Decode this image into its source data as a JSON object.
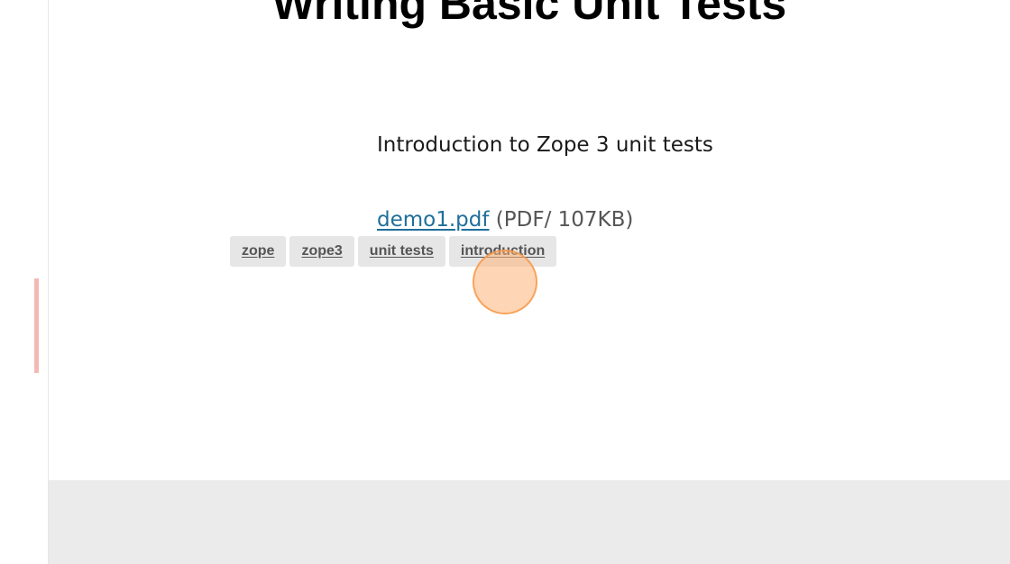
{
  "article": {
    "title": "Writing Basic Unit Tests",
    "description": "Introduction to Zope 3 unit tests"
  },
  "attachment": {
    "filename": "demo1.pdf",
    "info": "(PDF/ 107KB)"
  },
  "tags": [
    {
      "label": "zope"
    },
    {
      "label": "zope3"
    },
    {
      "label": "unit tests"
    },
    {
      "label": "introduction"
    }
  ],
  "colors": {
    "link": "#1f6f9a",
    "tag_background": "#e6e6e6",
    "footer_background": "#ebebeb",
    "scroll_marker": "#f4b9b4",
    "click_indicator": "#ffb478"
  }
}
